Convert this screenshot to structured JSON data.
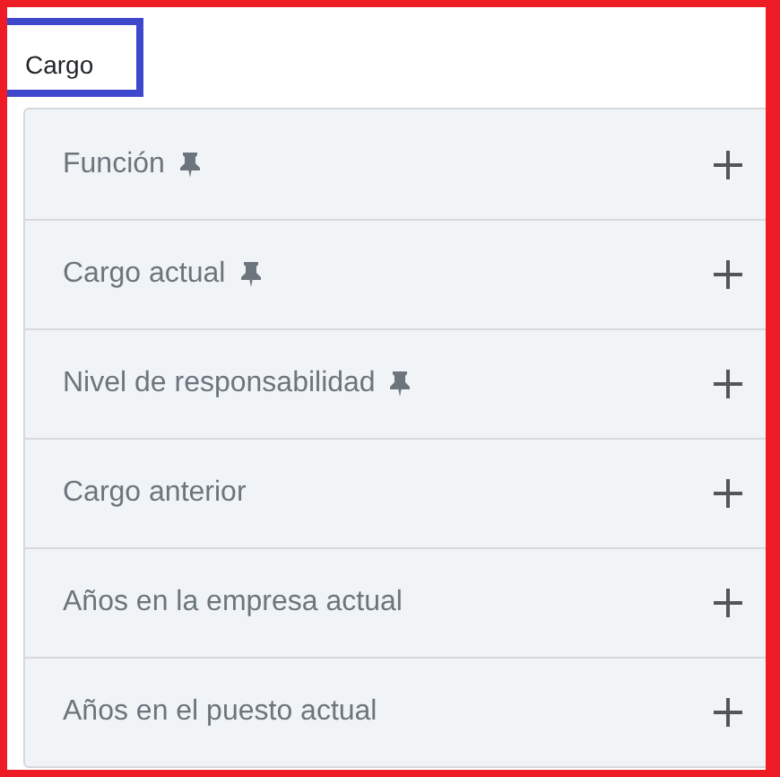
{
  "section": {
    "title": "Cargo"
  },
  "items": [
    {
      "label": "Función",
      "pinned": true,
      "expanded": false
    },
    {
      "label": "Cargo actual",
      "pinned": true,
      "expanded": false
    },
    {
      "label": "Nivel de responsabilidad",
      "pinned": true,
      "expanded": false
    },
    {
      "label": "Cargo anterior",
      "pinned": false,
      "expanded": false
    },
    {
      "label": "Años en la empresa actual",
      "pinned": false,
      "expanded": false
    },
    {
      "label": "Años en el puesto actual",
      "pinned": false,
      "expanded": false
    }
  ]
}
